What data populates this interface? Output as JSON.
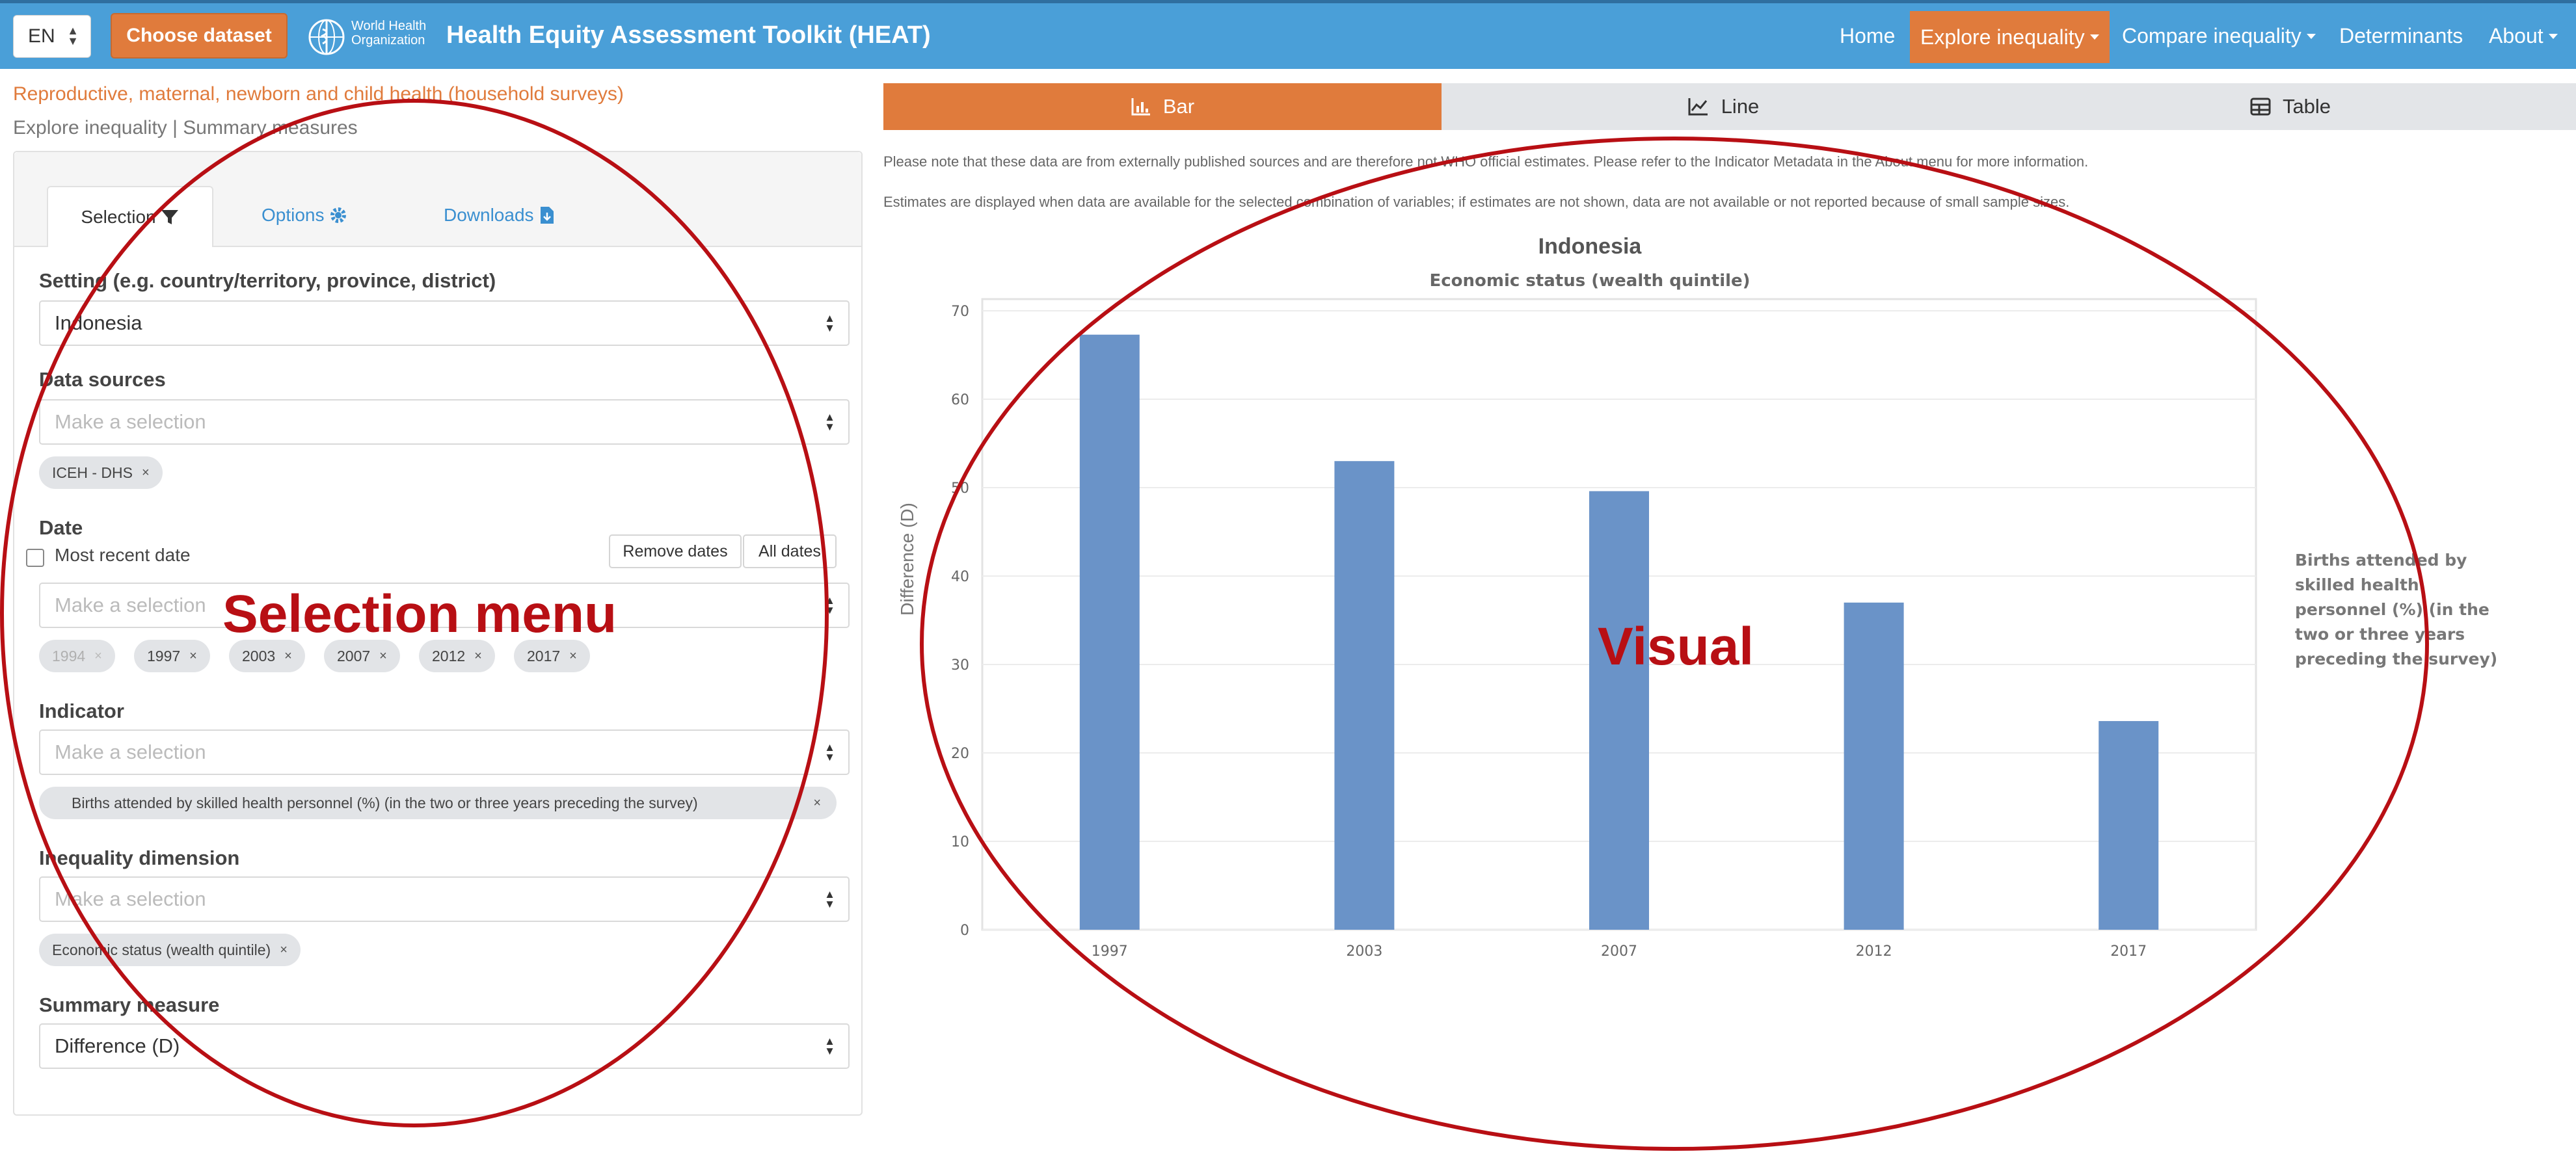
{
  "navbar": {
    "language": "EN",
    "choose_dataset": "Choose dataset",
    "who_text": "World Health Organization",
    "title": "Health Equity Assessment Toolkit (HEAT)",
    "items": [
      {
        "label": "Home"
      },
      {
        "label": "Explore inequality",
        "active": true
      },
      {
        "label": "Compare inequality"
      },
      {
        "label": "Determinants"
      },
      {
        "label": "About"
      }
    ]
  },
  "header": {
    "dataset_title": "Reproductive, maternal, newborn and child health (household surveys)",
    "breadcrumb": "Explore inequality | Summary measures"
  },
  "panel": {
    "tabs": {
      "selection": "Selection",
      "options": "Options",
      "downloads": "Downloads"
    },
    "setting": {
      "label": "Setting (e.g. country/territory, province, district)",
      "value": "Indonesia"
    },
    "data_sources": {
      "label": "Data sources",
      "placeholder": "Make a selection",
      "chips": [
        "ICEH - DHS"
      ]
    },
    "date": {
      "label": "Date",
      "most_recent": "Most recent date",
      "remove_dates": "Remove dates",
      "all_dates": "All dates",
      "placeholder": "Make a selection",
      "chips": [
        {
          "label": "1994",
          "muted": true
        },
        {
          "label": "1997"
        },
        {
          "label": "2003"
        },
        {
          "label": "2007"
        },
        {
          "label": "2012"
        },
        {
          "label": "2017"
        }
      ]
    },
    "indicator": {
      "label": "Indicator",
      "placeholder": "Make a selection",
      "chips": [
        "Births attended by skilled health personnel (%) (in the two or three years preceding the survey)"
      ]
    },
    "inequality_dimension": {
      "label": "Inequality dimension",
      "placeholder": "Make a selection",
      "chips": [
        "Economic status (wealth quintile)"
      ]
    },
    "summary_measure": {
      "label": "Summary measure",
      "value": "Difference (D)"
    }
  },
  "visual_tabs": {
    "bar": "Bar",
    "line": "Line",
    "table": "Table"
  },
  "notes": {
    "note1": "Please note that these data are from externally published sources and are therefore not WHO official estimates. Please refer to the Indicator Metadata in the About menu for more information.",
    "note2": "Estimates are displayed when data are available for the selected combination of variables; if estimates are not shown, data are not available or not reported because of small sample sizes."
  },
  "chart_data": {
    "type": "bar",
    "title": "Indonesia",
    "subtitle": "Economic status (wealth quintile)",
    "categories": [
      "1997",
      "2003",
      "2007",
      "2012",
      "2017"
    ],
    "values": [
      67.3,
      53.0,
      49.6,
      37.0,
      23.6
    ],
    "ylabel": "Difference (D)",
    "ylim": [
      0,
      70
    ],
    "yticks": [
      0,
      10,
      20,
      30,
      40,
      50,
      60,
      70
    ],
    "side_label": "Births attended by skilled health personnel (%) (in the two or three years preceding the survey)",
    "bar_color": "#6a93c8",
    "grid": true
  },
  "annotations": {
    "selection_menu": "Selection menu",
    "visual": "Visual",
    "color": "#b80f14"
  },
  "colors": {
    "navbar": "#4a9fd8",
    "accent": "#e07b3c",
    "link": "#3a8fd0"
  }
}
